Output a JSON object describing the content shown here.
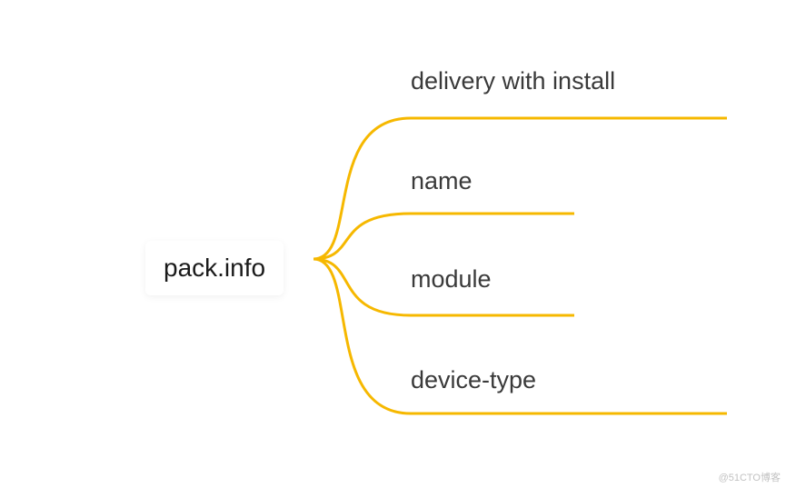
{
  "root": {
    "label": "pack.info"
  },
  "children": [
    {
      "label": "delivery with install"
    },
    {
      "label": "name"
    },
    {
      "label": "module"
    },
    {
      "label": "device-type"
    }
  ],
  "colors": {
    "connector": "#f6b800",
    "text": "#1a1a1a"
  },
  "watermark": "@51CTO博客"
}
